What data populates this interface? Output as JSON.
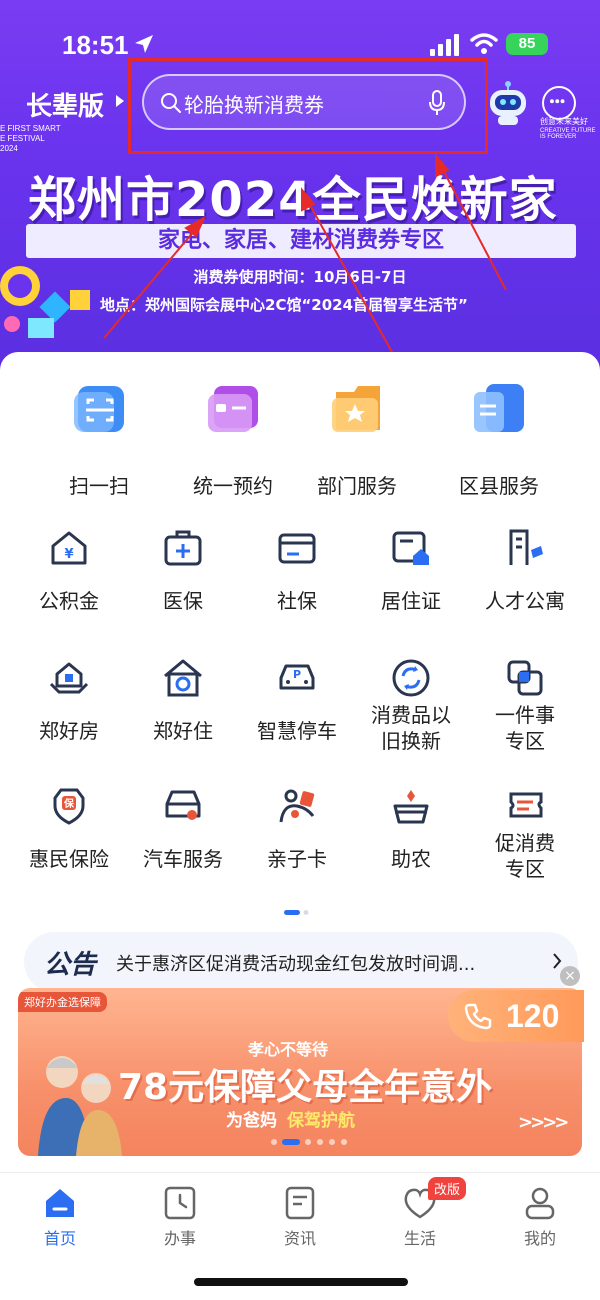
{
  "status_bar": {
    "time": "18:51",
    "battery": "85"
  },
  "header": {
    "elder_mode_label": "长辈版",
    "elder_caption": [
      "E FIRST SMART",
      "E FESTIVAL",
      "2024"
    ],
    "search_placeholder": "轮胎换新消费券",
    "more_caption": "创意未来美好",
    "more_caption_en": "CREATIVE FUTURE IS FOREVER"
  },
  "banner": {
    "title": "郑州市2024全民焕新家",
    "strip": "家电、家居、建材消费券专区",
    "time": "消费券使用时间：10月6日-7日",
    "address": "地点：郑州国际会展中心2C馆“2024首届智享生活节”"
  },
  "quick_services": [
    {
      "label": "扫一扫",
      "icon": "scan-icon",
      "color": "#3d8df5"
    },
    {
      "label": "统一预约",
      "icon": "appointment-icon",
      "color": "#b04ee8"
    },
    {
      "label": "部门服务",
      "icon": "department-icon",
      "color": "#f5a43a"
    },
    {
      "label": "区县服务",
      "icon": "county-icon",
      "color": "#3d7ff5"
    }
  ],
  "services": [
    {
      "label": "公积金",
      "icon": "housing-fund-icon"
    },
    {
      "label": "医保",
      "icon": "medical-insurance-icon"
    },
    {
      "label": "社保",
      "icon": "social-security-icon"
    },
    {
      "label": "居住证",
      "icon": "residence-permit-icon"
    },
    {
      "label": "人才公寓",
      "icon": "talent-apartment-icon"
    },
    {
      "label": "郑好房",
      "icon": "house-icon"
    },
    {
      "label": "郑好住",
      "icon": "home-stay-icon"
    },
    {
      "label": "智慧停车",
      "icon": "parking-icon"
    },
    {
      "label": "消费品以",
      "label2": "旧换新",
      "icon": "trade-in-icon"
    },
    {
      "label": "一件事",
      "label2": "专区",
      "icon": "one-thing-icon"
    },
    {
      "label": "惠民保险",
      "icon": "insurance-icon"
    },
    {
      "label": "汽车服务",
      "icon": "car-service-icon"
    },
    {
      "label": "亲子卡",
      "icon": "family-card-icon"
    },
    {
      "label": "助农",
      "icon": "agriculture-icon"
    },
    {
      "label": "促消费",
      "label2": "专区",
      "icon": "coupon-icon"
    }
  ],
  "notice": {
    "tag": "公告",
    "text": "关于惠济区促消费活动现金红包发放时间调..."
  },
  "call": {
    "number": "120"
  },
  "promo": {
    "tag": "郑好办金选保障",
    "sub": "孝心不等待",
    "title": "78元保障父母全年意外",
    "line_a": "为爸妈",
    "line_b": "保驾护航",
    "chevrons": ">>>>"
  },
  "tabs": [
    {
      "label": "首页",
      "icon": "home-icon",
      "active": true
    },
    {
      "label": "办事",
      "icon": "affairs-icon"
    },
    {
      "label": "资讯",
      "icon": "news-icon"
    },
    {
      "label": "生活",
      "icon": "life-icon",
      "badge": "改版"
    },
    {
      "label": "我的",
      "icon": "profile-icon"
    }
  ],
  "colors": {
    "hero": "#6a33ee",
    "accent": "#2b6ef2",
    "highlight": "#e62a2a",
    "icon_stroke": "#2a3550",
    "icon_accent": "#2b6ef2"
  }
}
